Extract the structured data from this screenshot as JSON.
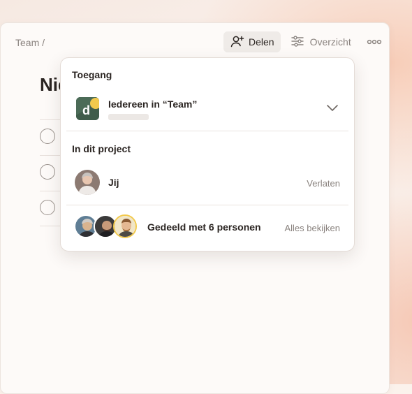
{
  "header": {
    "breadcrumb": "Team /",
    "share_label": "Delen",
    "overview_label": "Overzicht"
  },
  "background": {
    "title_fragment": "Nie"
  },
  "popover": {
    "access_heading": "Toegang",
    "access_option": "Iedereen in “Team”",
    "project_heading": "In dit project",
    "me_name": "Jij",
    "leave_label": "Verlaten",
    "shared_text": "Gedeeld met 6 personen",
    "see_all_label": "Alles bekijken"
  },
  "icons": {
    "share": "add-person-icon",
    "overview": "sliders-icon",
    "more": "more-horizontal-icon",
    "dropdown": "chevron-down-icon",
    "team_logo": "letter-d-logo"
  },
  "colors": {
    "accent_bg": "#efebe8",
    "text_primary": "#2b2522",
    "text_muted": "#8a837f",
    "logo_green": "#3f5c4a",
    "logo_yellow": "#f2c94c"
  }
}
